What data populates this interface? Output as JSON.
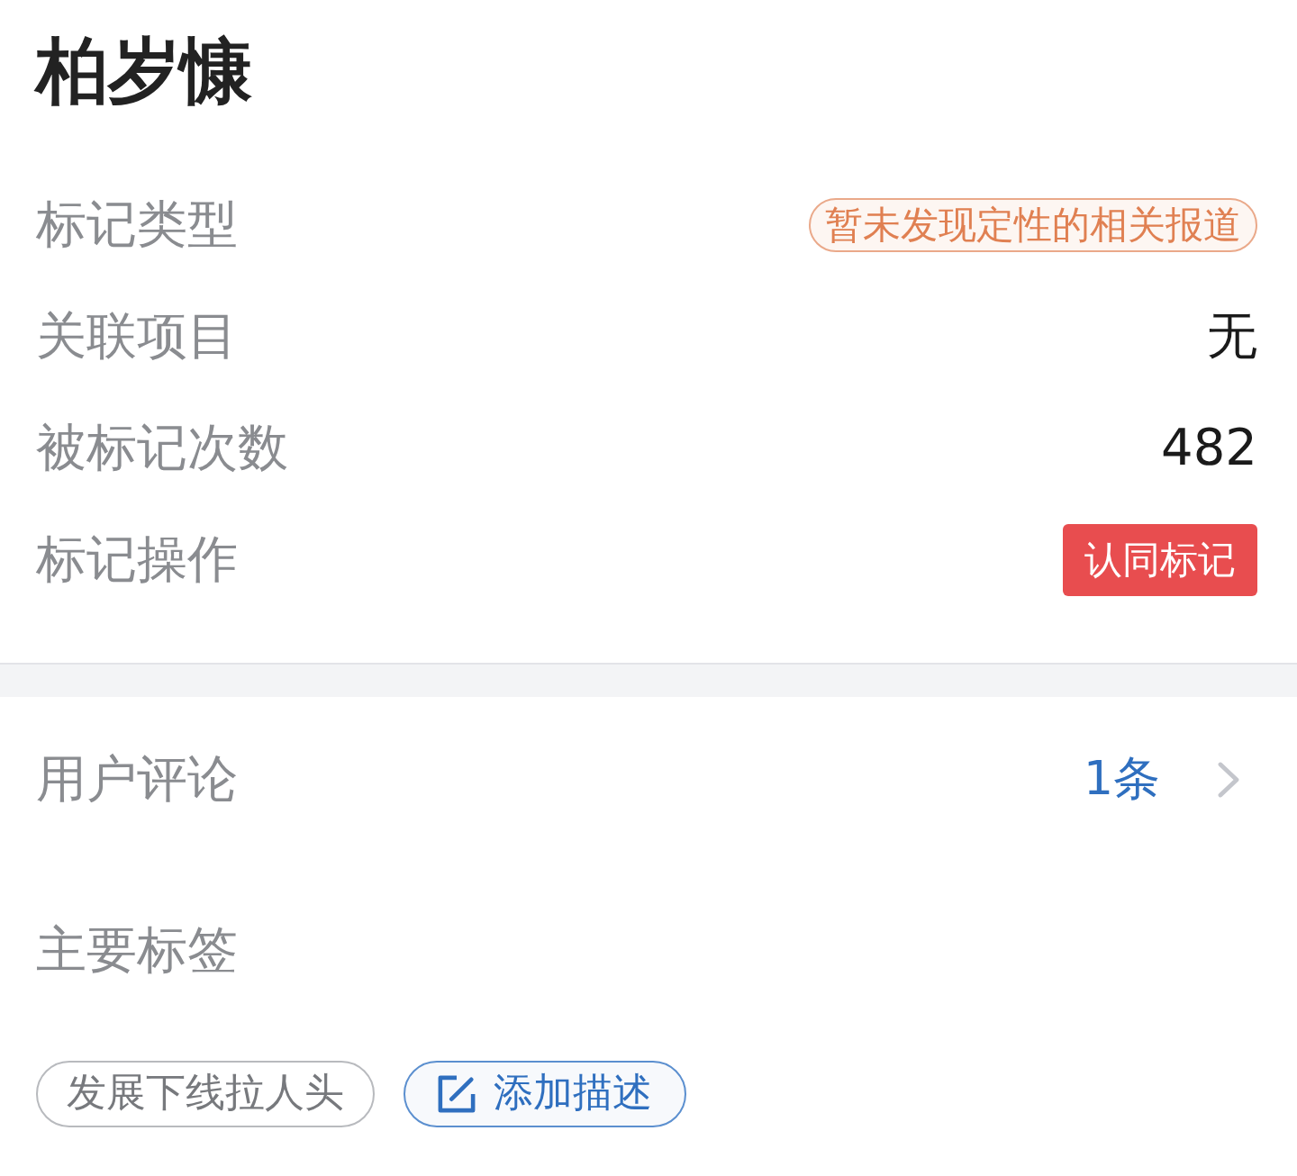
{
  "title": "柏岁慷",
  "fields": [
    {
      "label": "标记类型",
      "kind": "badge",
      "value": "暂未发现定性的相关报道"
    },
    {
      "label": "关联项目",
      "kind": "text",
      "value": "无"
    },
    {
      "label": "被标记次数",
      "kind": "text",
      "value": "482"
    },
    {
      "label": "标记操作",
      "kind": "button",
      "value": "认同标记"
    }
  ],
  "comments": {
    "label": "用户评论",
    "count": "1条"
  },
  "tags": {
    "label": "主要标签",
    "items": [
      {
        "kind": "tag",
        "text": "发展下线拉人头"
      },
      {
        "kind": "add",
        "text": "添加描述"
      }
    ]
  }
}
